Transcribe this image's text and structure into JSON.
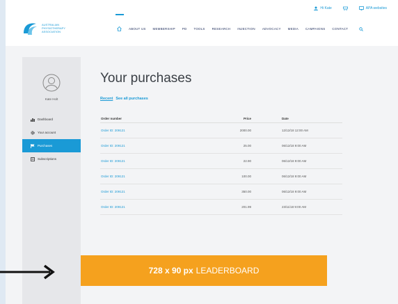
{
  "header": {
    "logo_text_line1": "AUSTRALIAN",
    "logo_text_line2": "PHYSIOTHERAPY",
    "logo_text_line3": "ASSOCIATION",
    "top_links": [
      {
        "label": "Hi Kate",
        "icon": "user-icon"
      },
      {
        "label": "",
        "icon": "basket-icon"
      },
      {
        "label": "APA websites",
        "icon": "monitor-icon"
      }
    ],
    "nav": [
      "ABOUT US",
      "MEMBERSHIP",
      "PD",
      "TOOLS",
      "RESEARCH",
      "INJECTION",
      "ADVOCACY",
      "MEDIA",
      "CAMPAIGNS",
      "CONTACT"
    ]
  },
  "sidebar": {
    "username": "Kate Holt",
    "items": [
      {
        "label": "Dashboard",
        "icon": "dashboard-icon",
        "active": false
      },
      {
        "label": "Your account",
        "icon": "gear-icon",
        "active": false
      },
      {
        "label": "Purchases",
        "icon": "flag-icon",
        "active": true
      },
      {
        "label": "Subscriptions",
        "icon": "subscriptions-icon",
        "active": false
      }
    ]
  },
  "main": {
    "title": "Your purchases",
    "tabs": {
      "recent": "Recent",
      "all": "See all purchases"
    },
    "table": {
      "headers": [
        "Order number",
        "Price",
        "Date"
      ],
      "rows": [
        [
          "Order ID: 209121",
          "2000.00",
          "12/12/18  12:00 AM"
        ],
        [
          "Order ID: 209121",
          "25.00",
          "06/12/18  9:00 AM"
        ],
        [
          "Order ID: 209121",
          "22.90",
          "06/12/18  9:00 AM"
        ],
        [
          "Order ID: 209121",
          "100.00",
          "06/12/18  9:00 AM"
        ],
        [
          "Order ID: 209121",
          "350.00",
          "06/12/18  9:00 AM"
        ],
        [
          "Order ID: 209121",
          "201.99",
          "23/11/18  9:00 AM"
        ]
      ]
    }
  },
  "banner": {
    "size": "728 x 90 px",
    "label": "LEADERBOARD"
  },
  "colors": {
    "accent": "#1a9ad6",
    "banner": "#f5a11e",
    "navy": "#1d2c5a"
  }
}
